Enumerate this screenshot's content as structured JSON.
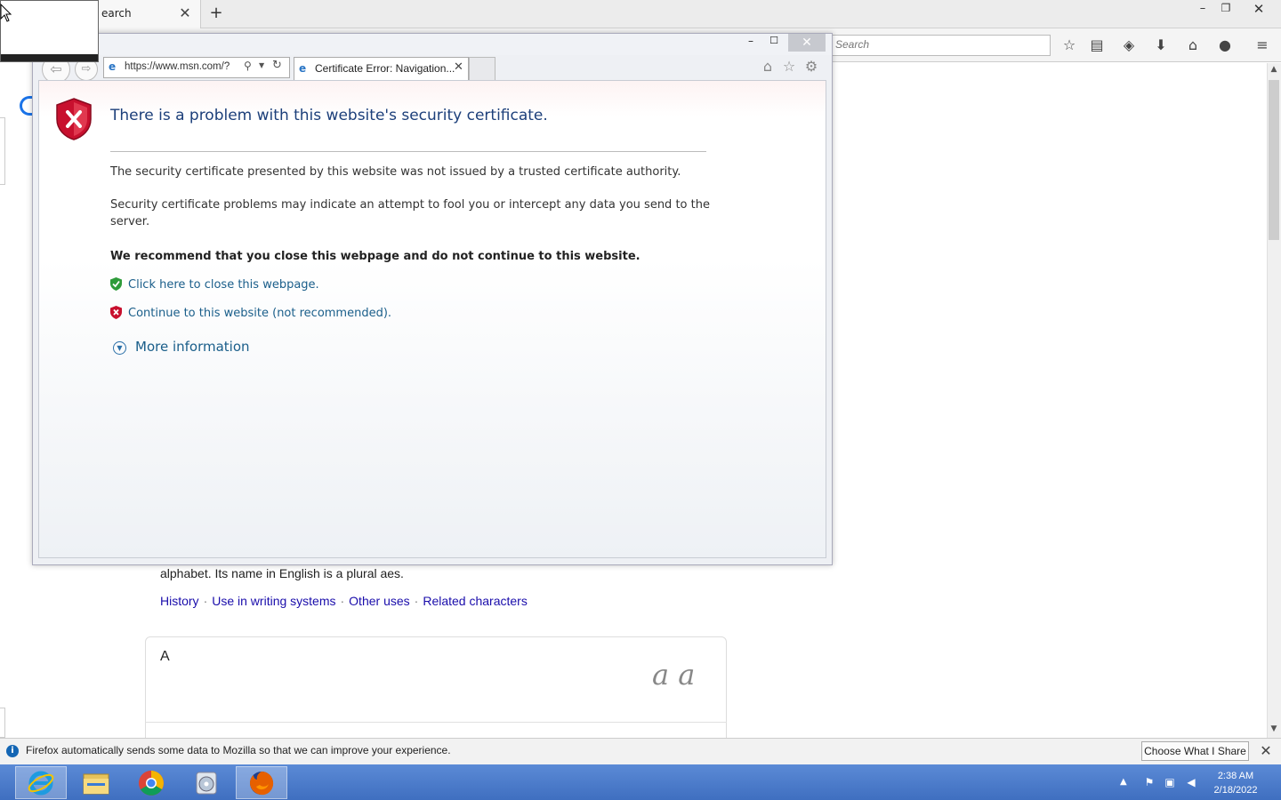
{
  "firefox": {
    "tab_title": "earch",
    "tab_close": "✕",
    "new_tab": "+",
    "window_min": "–",
    "window_max": "❐",
    "window_close": "✕",
    "search_placeholder": "Search",
    "tools": [
      "star-icon",
      "reading-list-icon",
      "pocket-icon",
      "download-icon",
      "home-icon",
      "chat-icon",
      "menu-icon"
    ]
  },
  "ie": {
    "address_url": "https://www.msn.com/?",
    "tab_title": "Certificate Error: Navigation...",
    "tab_close": "✕",
    "window_min": "–",
    "window_max": "☐",
    "window_close": "✕",
    "error": {
      "heading": "There is a problem with this website's security certificate.",
      "p1": "The security certificate presented by this website was not issued by a trusted certificate authority.",
      "p2": "Security certificate problems may indicate an attempt to fool you or intercept any data you send to the server.",
      "recommend": "We recommend that you close this webpage and do not continue to this website.",
      "close_link": "Click here to close this webpage.",
      "continue_link": "Continue to this website (not recommended).",
      "more_info": "More information"
    }
  },
  "background_page": {
    "text": "alphabet. Its name in English is a plural aes.",
    "links": [
      "History",
      "Use in writing systems",
      "Other uses",
      "Related characters"
    ],
    "separator": "·",
    "card_letter": "A",
    "card_script": "a a"
  },
  "notification": {
    "text": "Firefox automatically sends some data to Mozilla so that we can improve your experience.",
    "button": "Choose What I Share",
    "close": "✕"
  },
  "taskbar": {
    "apps": [
      "internet-explorer",
      "file-explorer",
      "chrome",
      "media-center",
      "firefox"
    ],
    "time": "2:38 AM",
    "date": "2/18/2022"
  },
  "colors": {
    "taskbar": "#4a7bcb",
    "link": "#1a5e8a",
    "heading": "#1c3f7a",
    "error_red": "#c8102e"
  }
}
